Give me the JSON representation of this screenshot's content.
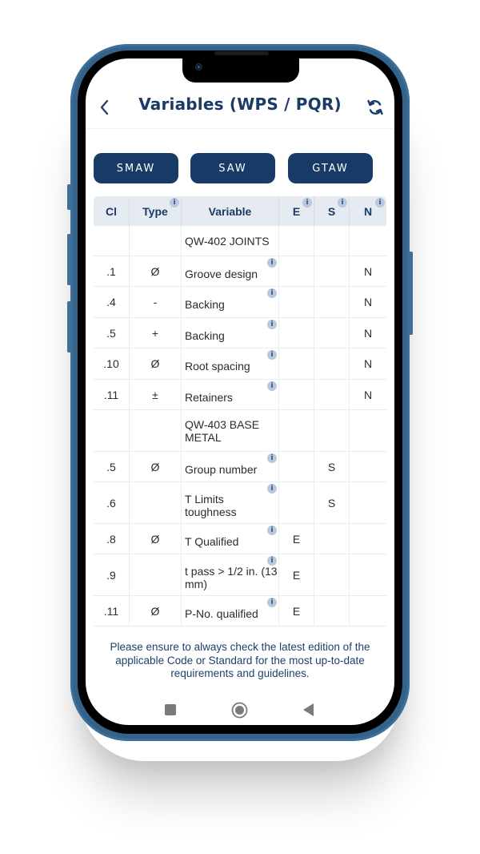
{
  "header": {
    "title": "Variables (WPS / PQR)",
    "back_icon": "chevron-left-icon",
    "refresh_icon": "refresh-icon"
  },
  "process_buttons": [
    {
      "label": "SMAW"
    },
    {
      "label": "SAW"
    },
    {
      "label": "GTAW"
    }
  ],
  "table": {
    "columns": [
      {
        "label": "Cl",
        "info": false
      },
      {
        "label": "Type",
        "info": true
      },
      {
        "label": "Variable",
        "info": false
      },
      {
        "label": "E",
        "info": true
      },
      {
        "label": "S",
        "info": true
      },
      {
        "label": "N",
        "info": true
      }
    ],
    "info_glyph": "i",
    "rows": [
      {
        "kind": "section",
        "cl": "",
        "type": "",
        "variable": "QW-402 JOINTS",
        "e": "",
        "s": "",
        "n": ""
      },
      {
        "kind": "item",
        "cl": ".1",
        "type": "Ø",
        "variable": "Groove design",
        "e": "",
        "s": "",
        "n": "N"
      },
      {
        "kind": "item",
        "cl": ".4",
        "type": "-",
        "variable": "Backing",
        "e": "",
        "s": "",
        "n": "N"
      },
      {
        "kind": "item",
        "cl": ".5",
        "type": "+",
        "variable": "Backing",
        "e": "",
        "s": "",
        "n": "N"
      },
      {
        "kind": "item",
        "cl": ".10",
        "type": "Ø",
        "variable": "Root spacing",
        "e": "",
        "s": "",
        "n": "N"
      },
      {
        "kind": "item",
        "cl": ".11",
        "type": "±",
        "variable": "Retainers",
        "e": "",
        "s": "",
        "n": "N"
      },
      {
        "kind": "section",
        "cl": "",
        "type": "",
        "variable": "QW-403 BASE METAL",
        "e": "",
        "s": "",
        "n": ""
      },
      {
        "kind": "item",
        "cl": ".5",
        "type": "Ø",
        "variable": "Group number",
        "e": "",
        "s": "S",
        "n": ""
      },
      {
        "kind": "item",
        "cl": ".6",
        "type": "",
        "variable": "T Limits toughness",
        "e": "",
        "s": "S",
        "n": ""
      },
      {
        "kind": "item",
        "cl": ".8",
        "type": "Ø",
        "variable": "T Qualified",
        "e": "E",
        "s": "",
        "n": ""
      },
      {
        "kind": "item",
        "cl": ".9",
        "type": "",
        "variable": "t pass > 1/2 in. (13 mm)",
        "e": "E",
        "s": "",
        "n": ""
      },
      {
        "kind": "item",
        "cl": ".11",
        "type": "Ø",
        "variable": "P-No. qualified",
        "e": "E",
        "s": "",
        "n": ""
      }
    ]
  },
  "notice": "Please ensure to always check the latest edition of the applicable Code or Standard for the most up-to-date requirements and guidelines.",
  "navbar": [
    {
      "icon": "recent-apps-icon"
    },
    {
      "icon": "home-icon"
    },
    {
      "icon": "back-icon"
    }
  ],
  "colors": {
    "primary": "#183a66",
    "title": "#1b3a66",
    "header_bg": "#e6ebf2",
    "phone_frame": "#33628a"
  }
}
